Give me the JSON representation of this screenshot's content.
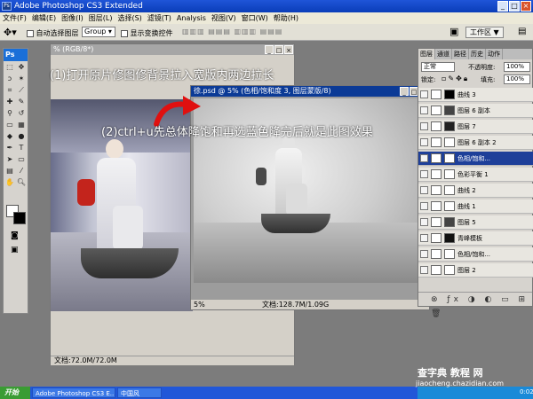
{
  "app": {
    "title": "Adobe Photoshop CS3 Extended"
  },
  "menu": [
    "文件(F)",
    "编辑(E)",
    "图像(I)",
    "图层(L)",
    "选择(S)",
    "滤镜(T)",
    "Analysis",
    "视图(V)",
    "窗口(W)",
    "帮助(H)"
  ],
  "options": {
    "auto_select_label": "自动选择图层",
    "group_value": "Group",
    "show_transform_label": "显示变换控件",
    "workspace_label": "工作区 ▼"
  },
  "left_doc": {
    "title": "% (RGB/8*)",
    "status": "文档:72.0M/72.0M"
  },
  "main_doc": {
    "title": "徐.psd @ 5% (色相/饱和度 3, 图层蒙版/8)",
    "zoom": "5%",
    "status": "文档:128.7M/1.09G"
  },
  "annotations": {
    "step1": "(1)打开原片修图修背景拉入宽版内两边拉长",
    "step2": "(2)ctrl+u先总体降饱和再选蓝色降完后就是此图效果"
  },
  "layers_panel": {
    "tabs": [
      "图层",
      "通道",
      "路径",
      "历史",
      "动作"
    ],
    "blend_mode": "正常",
    "opacity_label": "不透明度:",
    "opacity_value": "100%",
    "lock_label": "锁定:",
    "fill_label": "填充:",
    "fill_value": "100%",
    "rows": [
      "曲线 3",
      "图层 6 副本",
      "图层 7",
      "图层 6 副本 2",
      "色相/饱和...",
      "色彩平衡 1",
      "曲线 2",
      "曲线 1",
      "图层 5",
      "青峰模板",
      "色相/饱和...",
      "图层 2"
    ],
    "selected_index": 4
  },
  "taskbar": {
    "start_label": "开始",
    "items": [
      "Adobe Photoshop CS3 E...",
      "中国风"
    ],
    "clock": "0:02"
  },
  "watermark": {
    "site_name": "查字典 教程 网",
    "site_url": "jiaocheng.chazidian.com"
  },
  "colors": {
    "title_bar": "#0a3db8",
    "workspace_bg": "#7c7c7c",
    "selected_layer": "#1e3f99",
    "taskbar": "#2157d8",
    "start_button": "#3a9c33",
    "arrow": "#e01010"
  }
}
